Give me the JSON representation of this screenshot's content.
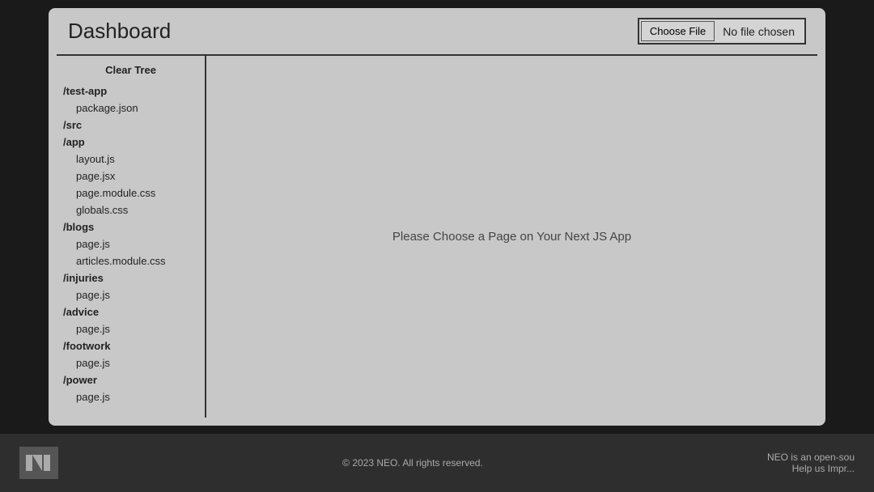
{
  "header": {
    "title": "Dashboard",
    "file_input": {
      "button_label": "Choose File",
      "no_file_text": "No file chosen"
    }
  },
  "sidebar": {
    "clear_tree_label": "Clear Tree",
    "items": [
      {
        "type": "folder",
        "label": "/test-app"
      },
      {
        "type": "file",
        "label": "package.json"
      },
      {
        "type": "folder",
        "label": "/src"
      },
      {
        "type": "folder",
        "label": "/app"
      },
      {
        "type": "file",
        "label": "layout.js"
      },
      {
        "type": "file",
        "label": "page.jsx"
      },
      {
        "type": "file",
        "label": "page.module.css"
      },
      {
        "type": "file",
        "label": "globals.css"
      },
      {
        "type": "folder",
        "label": "/blogs"
      },
      {
        "type": "file",
        "label": "page.js"
      },
      {
        "type": "file",
        "label": "articles.module.css"
      },
      {
        "type": "folder",
        "label": "/injuries"
      },
      {
        "type": "file",
        "label": "page.js"
      },
      {
        "type": "folder",
        "label": "/advice"
      },
      {
        "type": "file",
        "label": "page.js"
      },
      {
        "type": "folder",
        "label": "/footwork"
      },
      {
        "type": "file",
        "label": "page.js"
      },
      {
        "type": "folder",
        "label": "/power"
      },
      {
        "type": "file",
        "label": "page.js"
      }
    ]
  },
  "main_panel": {
    "placeholder": "Please Choose a Page on Your Next JS App"
  },
  "footer": {
    "copyright": "© 2023 NEO. All rights reserved.",
    "info_line1": "NEO is an open-sou",
    "info_line2": "Help us Impr..."
  }
}
